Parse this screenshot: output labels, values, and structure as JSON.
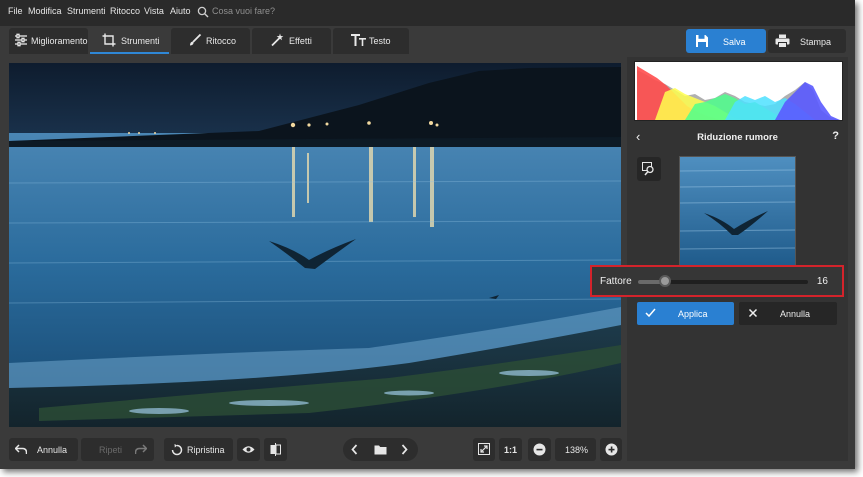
{
  "menu": {
    "items": [
      "File",
      "Modifica",
      "Strumenti",
      "Ritocco",
      "Vista",
      "Aiuto"
    ],
    "search_placeholder": "Cosa vuoi fare?"
  },
  "tabs": [
    {
      "label": "Miglioramento",
      "icon": "sliders-icon"
    },
    {
      "label": "Strumenti",
      "icon": "crop-icon",
      "active": true
    },
    {
      "label": "Ritocco",
      "icon": "brush-icon"
    },
    {
      "label": "Effetti",
      "icon": "magic-wand-icon"
    },
    {
      "label": "Testo",
      "icon": "text-icon"
    }
  ],
  "toolbar": {
    "save_label": "Salva",
    "print_label": "Stampa"
  },
  "panel": {
    "title": "Riduzione rumore",
    "help": "?",
    "factor_label": "Fattore",
    "factor_value": "16",
    "factor_fraction": 0.16,
    "apply_label": "Applica",
    "cancel_label": "Annulla"
  },
  "bottom": {
    "undo_label": "Annulla",
    "redo_label": "Ripeti",
    "reset_label": "Ripristina",
    "ratio_label": "1:1",
    "zoom_value": "138%"
  },
  "colors": {
    "accent": "#2a80d2",
    "highlight_border": "#d4232b",
    "panel_bg": "#333333",
    "menubar_bg": "#2a2a2a"
  }
}
